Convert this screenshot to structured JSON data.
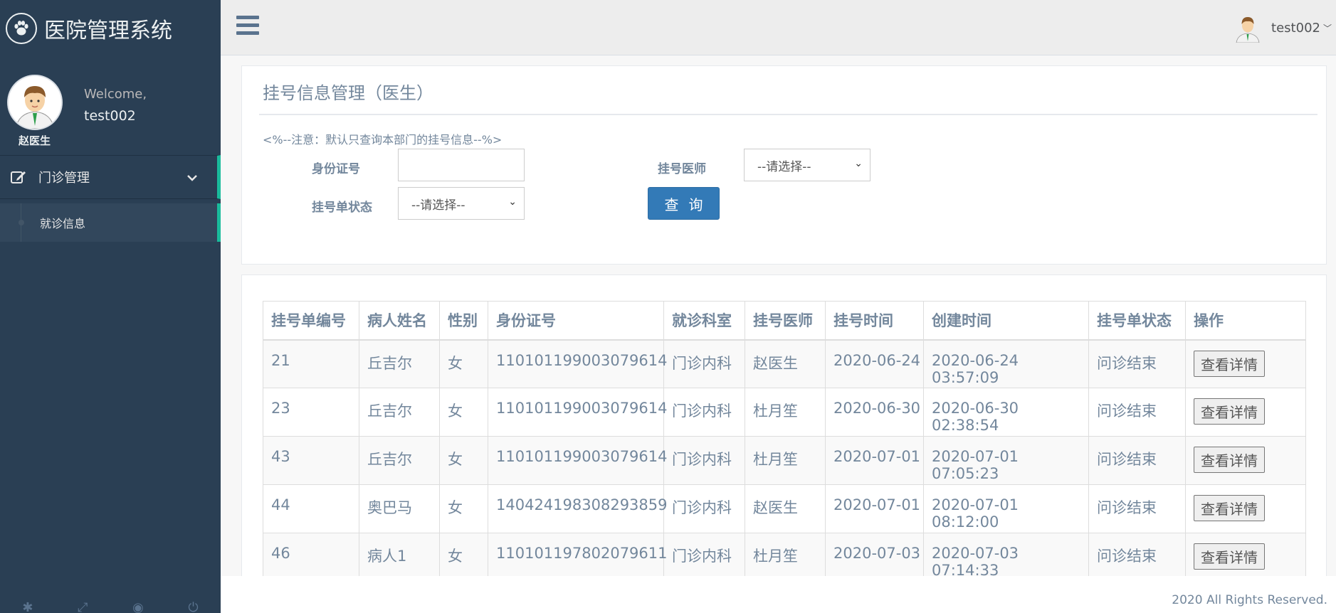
{
  "app": {
    "title": "医院管理系统"
  },
  "profile": {
    "welcome": "Welcome,",
    "username": "test002",
    "doctor_name": "赵医生"
  },
  "menu": {
    "section_label": "门诊管理",
    "items": [
      {
        "label": "就诊信息"
      }
    ]
  },
  "topnav": {
    "username": "test002"
  },
  "page": {
    "title": "挂号信息管理（医生）",
    "note": "<%--注意：默认只查询本部门的挂号信息--%>"
  },
  "filters": {
    "id_label": "身份证号",
    "id_value": "",
    "doctor_label": "挂号医师",
    "doctor_selected": "--请选择--",
    "status_label": "挂号单状态",
    "status_selected": "--请选择--",
    "query_label": "查询"
  },
  "table": {
    "headers": [
      "挂号单编号",
      "病人姓名",
      "性别",
      "身份证号",
      "就诊科室",
      "挂号医师",
      "挂号时间",
      "创建时间",
      "挂号单状态",
      "操作"
    ],
    "rows": [
      [
        "21",
        "丘吉尔",
        "女",
        "110101199003079614",
        "门诊内科",
        "赵医生",
        "2020-06-24",
        "2020-06-24 03:57:09",
        "问诊结束",
        "查看详情"
      ],
      [
        "23",
        "丘吉尔",
        "女",
        "110101199003079614",
        "门诊内科",
        "杜月笙",
        "2020-06-30",
        "2020-06-30 02:38:54",
        "问诊结束",
        "查看详情"
      ],
      [
        "43",
        "丘吉尔",
        "女",
        "110101199003079614",
        "门诊内科",
        "杜月笙",
        "2020-07-01",
        "2020-07-01 07:05:23",
        "问诊结束",
        "查看详情"
      ],
      [
        "44",
        "奥巴马",
        "女",
        "140424198308293859",
        "门诊内科",
        "赵医生",
        "2020-07-01",
        "2020-07-01 08:12:00",
        "问诊结束",
        "查看详情"
      ],
      [
        "46",
        "病人1",
        "女",
        "110101197802079611",
        "门诊内科",
        "杜月笙",
        "2020-07-03",
        "2020-07-03 07:14:33",
        "问诊结束",
        "查看详情"
      ]
    ]
  },
  "footer": {
    "text": "2020 All Rights Reserved."
  },
  "colors": {
    "sidebar": "#2a3f54",
    "accent": "#1abb9c",
    "primary_button": "#337ab7",
    "text": "#73879c"
  },
  "icons": [
    "paw-icon",
    "edit-icon",
    "chevron-down-icon",
    "hamburger-icon",
    "settings-icon",
    "fullscreen-icon",
    "eye-slash-icon",
    "power-icon"
  ]
}
